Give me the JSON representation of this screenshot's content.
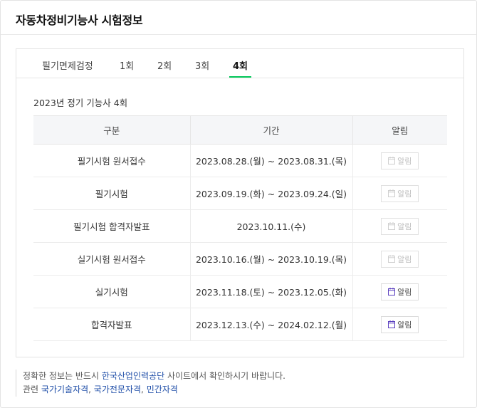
{
  "page": {
    "title": "자동차정비기능사 시험정보"
  },
  "tabs": [
    {
      "label": "필기면제검정",
      "active": false
    },
    {
      "label": "1회",
      "active": false
    },
    {
      "label": "2회",
      "active": false
    },
    {
      "label": "3회",
      "active": false
    },
    {
      "label": "4회",
      "active": true
    }
  ],
  "colors": {
    "accent": "#03c75a",
    "link": "#1f4ea8",
    "icon_enabled": "#5a3fbf",
    "icon_disabled": "#cfcfcf"
  },
  "schedule": {
    "subtitle": "2023년 정기 기능사 4회",
    "headers": [
      "구분",
      "기간",
      "알림"
    ],
    "rows": [
      {
        "category": "필기시험 원서접수",
        "period": "2023.08.28.(월) ~ 2023.08.31.(목)",
        "alarm_label": "알림",
        "alarm_enabled": false
      },
      {
        "category": "필기시험",
        "period": "2023.09.19.(화) ~ 2023.09.24.(일)",
        "alarm_label": "알림",
        "alarm_enabled": false
      },
      {
        "category": "필기시험 합격자발표",
        "period": "2023.10.11.(수)",
        "alarm_label": "알림",
        "alarm_enabled": false
      },
      {
        "category": "실기시험 원서접수",
        "period": "2023.10.16.(월) ~ 2023.10.19.(목)",
        "alarm_label": "알림",
        "alarm_enabled": false
      },
      {
        "category": "실기시험",
        "period": "2023.11.18.(토) ~ 2023.12.05.(화)",
        "alarm_label": "알림",
        "alarm_enabled": true
      },
      {
        "category": "합격자발표",
        "period": "2023.12.13.(수) ~ 2024.02.12.(월)",
        "alarm_label": "알림",
        "alarm_enabled": true
      }
    ]
  },
  "notes": {
    "line1_prefix": "정확한 정보는 반드시 ",
    "line1_link": "한국산업인력공단",
    "line1_suffix": " 사이트에서 확인하시기 바랍니다.",
    "line2_prefix": "관련 ",
    "related_links": [
      "국가기술자격",
      "국가전문자격",
      "민간자격"
    ],
    "separator": ", "
  }
}
